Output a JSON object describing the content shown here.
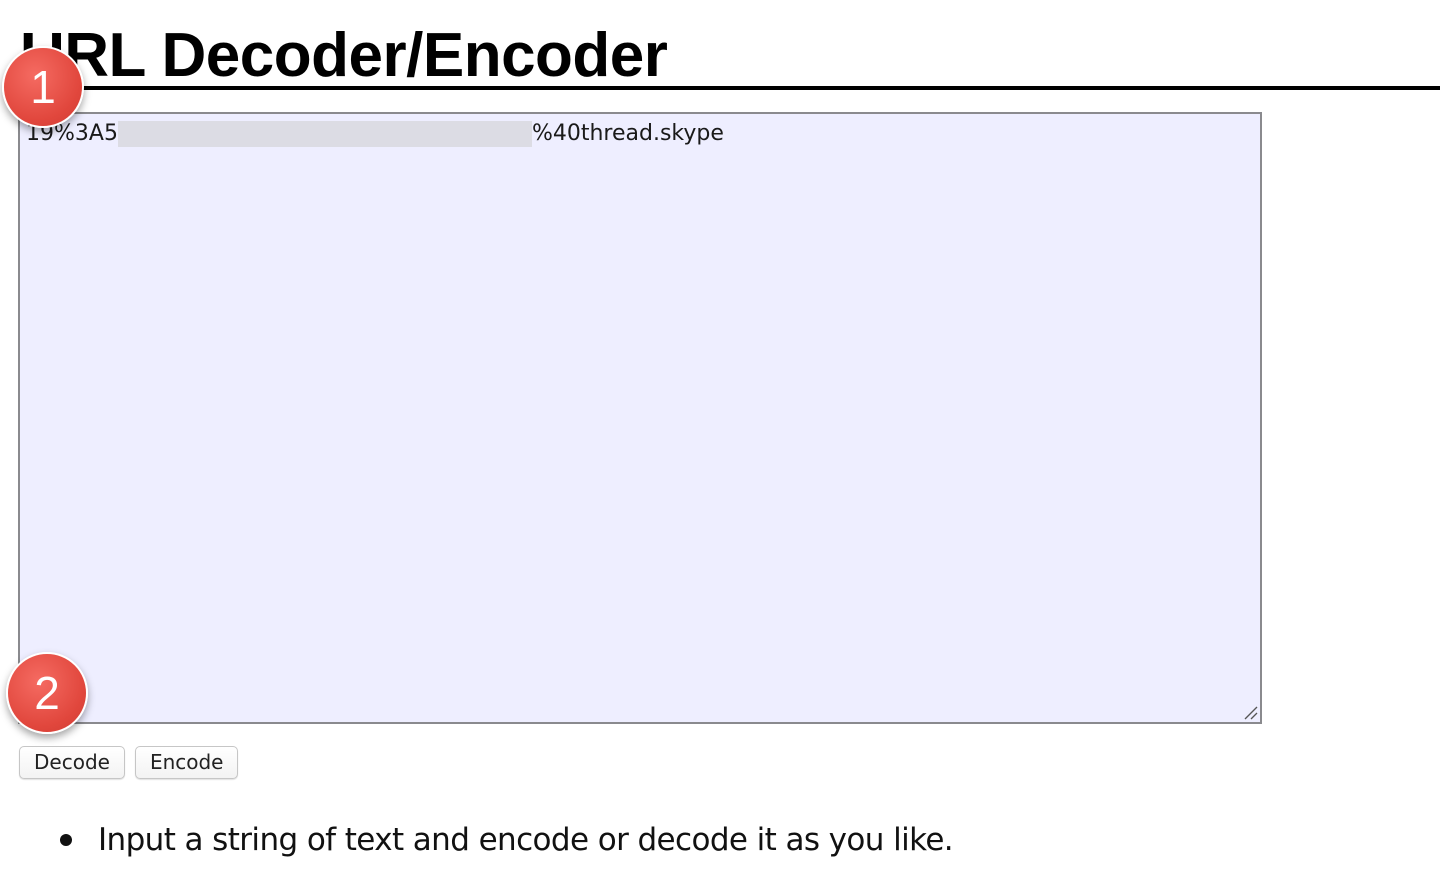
{
  "page": {
    "title": "URL Decoder/Encoder"
  },
  "textarea": {
    "value_start": "19%3A5",
    "value_end": "%40thread.skype",
    "background_color": "#eeeeff",
    "redacted": true
  },
  "buttons": {
    "decode_label": "Decode",
    "encode_label": "Encode"
  },
  "instructions": {
    "items": [
      "Input a string of text and encode or decode it as you like."
    ]
  },
  "annotations": {
    "badge_1": "1",
    "badge_2": "2",
    "badge_color": "#e1473d"
  }
}
